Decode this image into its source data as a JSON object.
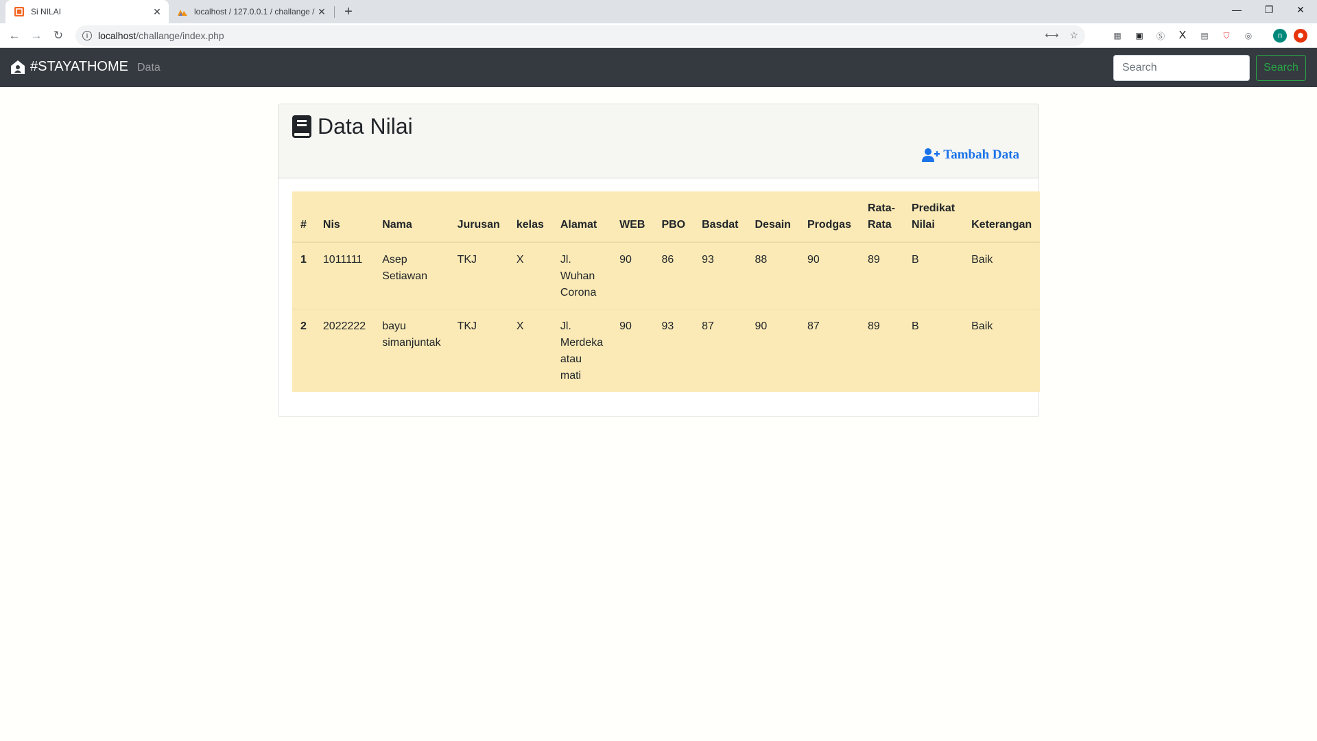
{
  "browser": {
    "tabs": [
      {
        "title": "Si NILAI",
        "active": true
      },
      {
        "title": "localhost / 127.0.0.1 / challange /",
        "active": false
      }
    ],
    "url_host": "localhost",
    "url_path": "/challange/index.php"
  },
  "navbar": {
    "brand": "#STAYATHOME",
    "link": "Data",
    "search_placeholder": "Search",
    "search_button": "Search"
  },
  "card": {
    "title": "Data Nilai",
    "add_label": "Tambah Data"
  },
  "table": {
    "headers": [
      "#",
      "Nis",
      "Nama",
      "Jurusan",
      "kelas",
      "Alamat",
      "WEB",
      "PBO",
      "Basdat",
      "Desain",
      "Prodgas",
      "Rata-Rata",
      "Predikat Nilai",
      "Keterangan"
    ],
    "rows": [
      {
        "no": "1",
        "nis": "1011111",
        "nama": "Asep Setiawan",
        "jurusan": "TKJ",
        "kelas": "X",
        "alamat": "Jl. Wuhan Corona",
        "web": "90",
        "pbo": "86",
        "basdat": "93",
        "desain": "88",
        "prodgas": "90",
        "rata": "89",
        "predikat": "B",
        "keterangan": "Baik"
      },
      {
        "no": "2",
        "nis": "2022222",
        "nama": "bayu simanjuntak",
        "jurusan": "TKJ",
        "kelas": "X",
        "alamat": "Jl. Merdeka atau mati",
        "web": "90",
        "pbo": "93",
        "basdat": "87",
        "desain": "90",
        "prodgas": "87",
        "rata": "89",
        "predikat": "B",
        "keterangan": "Baik"
      }
    ]
  },
  "colors": {
    "navbar_bg": "#343a40",
    "table_bg": "#fbeab6",
    "accent_link": "#1a73e8",
    "search_button": "#28a745"
  }
}
